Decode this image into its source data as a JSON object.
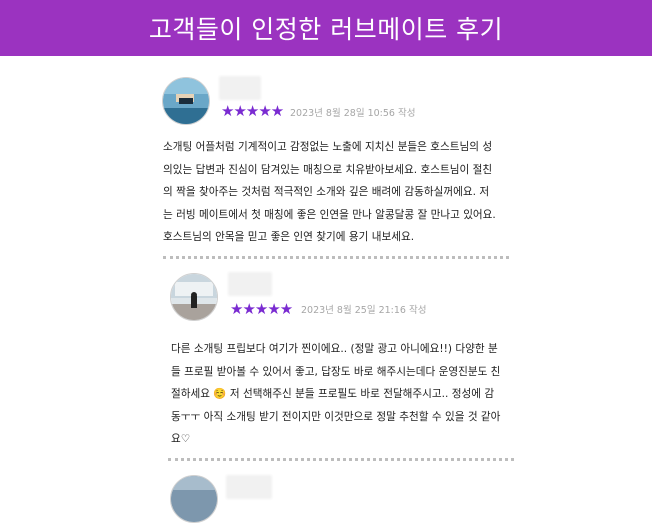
{
  "banner": {
    "title": "고객들이 인정한 러브메이트 후기",
    "color": "#9b33c0"
  },
  "reviews": [
    {
      "stars": "★★★★★",
      "date": "2023년 8월 28일 10:56 작성",
      "lines": [
        "소개팅 어플처럼 기계적이고 감정없는 노출에 지치신 분들은 호스트님의 성",
        "의있는 답변과 진심이 담겨있는 매칭으로 치유받아보세요. 호스트님이 절친",
        "의 짝을 찾아주는 것처럼 적극적인 소개와 깊은 배려에 감동하실꺼에요. 저",
        "는 러빙 메이트에서 첫 매칭에 좋은 인연을 만나 알콩달콩 잘 만나고 있어요.",
        "호스트님의 안목을 믿고 좋은 인연 찾기에 용기 내보세요."
      ]
    },
    {
      "stars": "★★★★★",
      "date": "2023년 8월 25일 21:16 작성",
      "lines": [
        "다른 소개팅 프립보다 여기가 찐이에요.. (정말 광고 아니에요!!) 다양한 분",
        "들 프로필 받아볼 수 있어서 좋고, 답장도 바로 해주시는데다 운영진분도 친",
        "절하세요 ☺️ 저 선택해주신 분들 프로필도 바로 전달해주시고.. 정성에 감",
        "동ㅜㅜ 아직 소개팅 받기 전이지만 이것만으로 정말 추천할 수 있을 것 같아",
        "요♡"
      ]
    }
  ],
  "star_color": "#7a2bd1"
}
